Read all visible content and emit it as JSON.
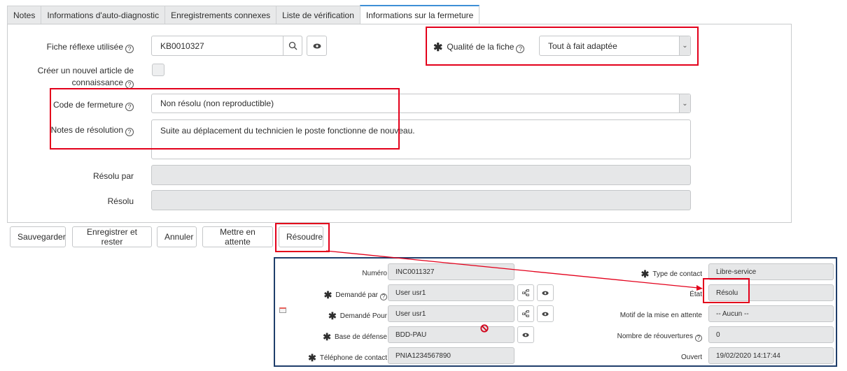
{
  "tabs": [
    {
      "label": "Notes",
      "active": false
    },
    {
      "label": "Informations d'auto-diagnostic",
      "active": false
    },
    {
      "label": "Enregistrements connexes",
      "active": false
    },
    {
      "label": "Liste de vérification",
      "active": false
    },
    {
      "label": "Informations sur la fermeture",
      "active": true
    }
  ],
  "form": {
    "kb_label": "Fiche réflexe utilisée",
    "kb_value": "KB0010327",
    "new_article_label_1": "Créer un nouvel article de",
    "new_article_label_2": "connaissance",
    "new_article_checked": false,
    "quality_label": "Qualité de la fiche",
    "quality_value": "Tout à fait adaptée",
    "close_code_label": "Code de fermeture",
    "close_code_value": "Non résolu (non reproductible)",
    "resolution_notes_label": "Notes de résolution",
    "resolution_notes_value": "Suite au déplacement du technicien le poste fonctionne de nouveau.",
    "resolved_by_label": "Résolu par",
    "resolved_by_value": "",
    "resolved_label": "Résolu",
    "resolved_value": "",
    "help_glyph": "?",
    "required_glyph": "✱"
  },
  "actions": {
    "save": "Sauvegarder",
    "save_stay": "Enregistrer et rester",
    "cancel": "Annuler",
    "on_hold": "Mettre en attente",
    "resolve": "Résoudre"
  },
  "inset": {
    "number_label": "Numéro",
    "number_value": "INC0011327",
    "requested_by_label": "Demandé par",
    "requested_by_value": "User usr1",
    "requested_for_label": "Demandé Pour",
    "requested_for_value": "User usr1",
    "defense_base_label": "Base de défense",
    "defense_base_value": "BDD-PAU",
    "phone_label": "Téléphone de contact",
    "phone_value": "PNIA1234567890",
    "contact_type_label": "Type de contact",
    "contact_type_value": "Libre-service",
    "state_label": "État",
    "state_value": "Résolu",
    "hold_reason_label": "Motif de la mise en attente",
    "hold_reason_value": "-- Aucun --",
    "reopen_count_label": "Nombre de réouvertures",
    "reopen_count_value": "0",
    "opened_label": "Ouvert",
    "opened_value": "19/02/2020 14:17:44"
  },
  "colors": {
    "highlight": "#e3001b",
    "active_tab": "#3d8fd6",
    "inset_border": "#1f3e6b"
  }
}
